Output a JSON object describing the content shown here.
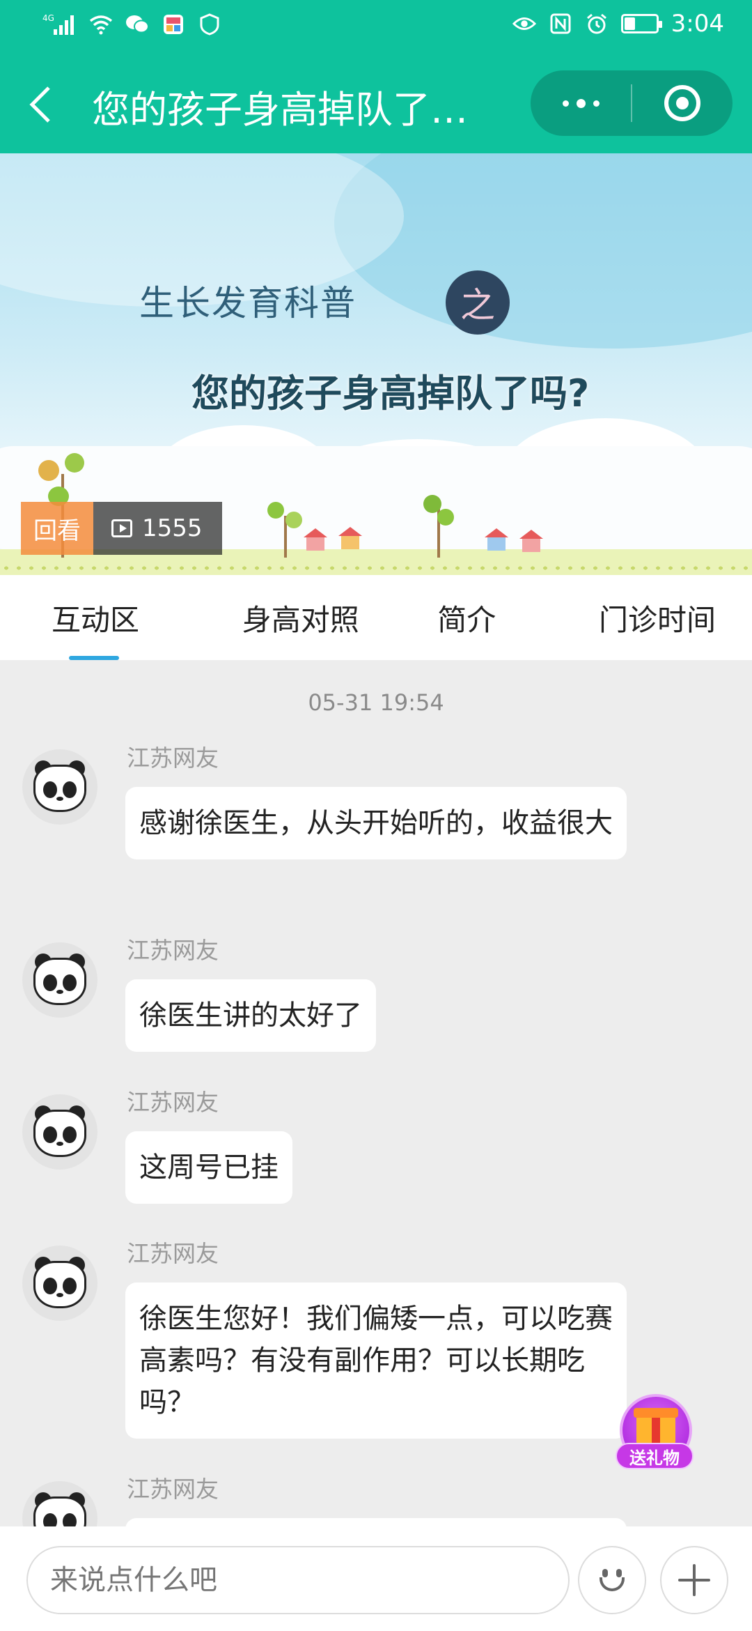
{
  "status_bar": {
    "time": "3:04",
    "network": "4G",
    "battery_level": 0.35
  },
  "header": {
    "title": "您的孩子身高掉队了吗？"
  },
  "banner": {
    "subtitle": "生长发育科普",
    "badge": "之",
    "title": "您的孩子身高掉队了吗?",
    "replay_label": "回看",
    "view_count": "1555"
  },
  "tabs": [
    {
      "label": "互动区",
      "active": true
    },
    {
      "label": "身高对照",
      "active": false
    },
    {
      "label": "简介",
      "active": false
    },
    {
      "label": "门诊时间",
      "active": false
    }
  ],
  "chat": {
    "timestamp": "05-31 19:54",
    "messages": [
      {
        "sender": "江苏网友",
        "text": "感谢徐医生，从头开始听的，收益很大"
      },
      {
        "sender": "江苏网友",
        "text": "徐医生讲的太好了"
      },
      {
        "sender": "江苏网友",
        "text": "这周号已挂"
      },
      {
        "sender": "江苏网友",
        "text": "徐医生您好！我们偏矮一点，可以吃赛高素吗？有没有副作用？可以长期吃吗？"
      },
      {
        "sender": "江苏网友",
        "text": ""
      }
    ]
  },
  "gift": {
    "label": "送礼物"
  },
  "composer": {
    "placeholder": "来说点什么吧"
  },
  "colors": {
    "brand": "#0ec29d",
    "tab_indicator": "#2ea7e0",
    "gift": "#b32fe2"
  }
}
